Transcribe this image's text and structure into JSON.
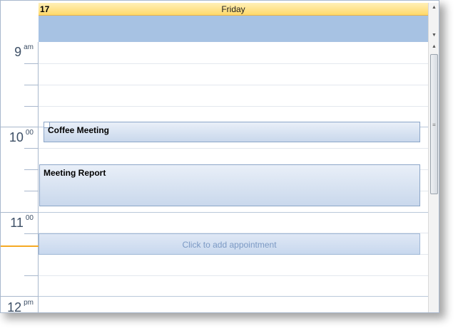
{
  "header": {
    "day_number": "17",
    "day_name": "Friday"
  },
  "time_labels": [
    {
      "hour": "9",
      "suffix": "am"
    },
    {
      "hour": "10",
      "suffix": "00"
    },
    {
      "hour": "11",
      "suffix": "00"
    },
    {
      "hour": "12",
      "suffix": "pm"
    }
  ],
  "appointments": [
    {
      "title": "Coffee Meeting"
    },
    {
      "title": "Meeting Report"
    }
  ],
  "new_appointment": {
    "label": "Click to add appointment"
  },
  "scrollbar": {
    "up_arrow": "▲",
    "down_arrow": "▼",
    "grip": "≡"
  },
  "colors": {
    "accent_now": "#f6a923",
    "all_day": "#a7c2e3",
    "header": "#ffd96a"
  }
}
